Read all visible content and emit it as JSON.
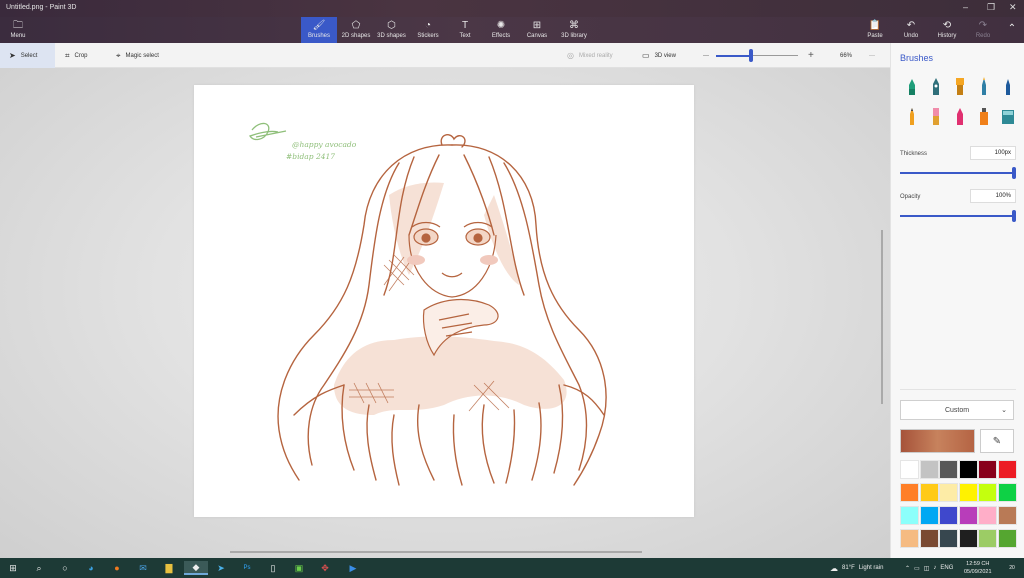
{
  "window": {
    "title": "Untitled.png - Paint 3D",
    "minimize": "–",
    "maximize": "❐",
    "close": "✕"
  },
  "ribbon": {
    "menu": "Menu",
    "brushes": "Brushes",
    "shapes2d": "2D shapes",
    "shapes3d": "3D shapes",
    "stickers": "Stickers",
    "text": "Text",
    "effects": "Effects",
    "canvas": "Canvas",
    "library3d": "3D library",
    "paste": "Paste",
    "undo": "Undo",
    "history": "History",
    "redo": "Redo",
    "collapse": "⌃"
  },
  "toolbar": {
    "select": "Select",
    "crop": "Crop",
    "magic_select": "Magic select",
    "mixed_reality": "Mixed reality",
    "view3d": "3D view",
    "zoom_minus": "—",
    "zoom_plus": "+",
    "zoom_level": "66%",
    "zoom_fraction": 0.43,
    "more": "···"
  },
  "artwork": {
    "signature_handle": "@happy avocado",
    "signature_tag": "#bidap 2417",
    "line_color": "#b5643f",
    "signature_color": "#8fbf7a"
  },
  "panel": {
    "title": "Brushes",
    "thickness_label": "Thickness",
    "thickness_value": "100px",
    "thickness_fraction": 1.0,
    "opacity_label": "Opacity",
    "opacity_value": "100%",
    "opacity_fraction": 1.0,
    "color_mode": "Custom",
    "current_color": "#b5643f",
    "eyedropper": "✎",
    "palette": [
      [
        "#ffffff",
        "#c3c3c3",
        "#585858",
        "#000000",
        "#88001b",
        "#ec1c24"
      ],
      [
        "#ff7f27",
        "#ffca18",
        "#fdeca6",
        "#fff200",
        "#c4ff0e",
        "#0ed145"
      ],
      [
        "#8cfffb",
        "#00a8f3",
        "#3f48cc",
        "#b83dba",
        "#ffaec8",
        "#b97a56"
      ],
      [
        "#f5bb82",
        "#7a4a32",
        "#37474f",
        "#1f1f1f",
        "#9ccc65",
        "#55a630"
      ]
    ]
  },
  "taskbar": {
    "weather_temp": "81°F",
    "weather_text": "Light rain",
    "lang": "ENG",
    "time": "12:59 CH",
    "date": "05/09/2021",
    "notification_count": "20"
  }
}
